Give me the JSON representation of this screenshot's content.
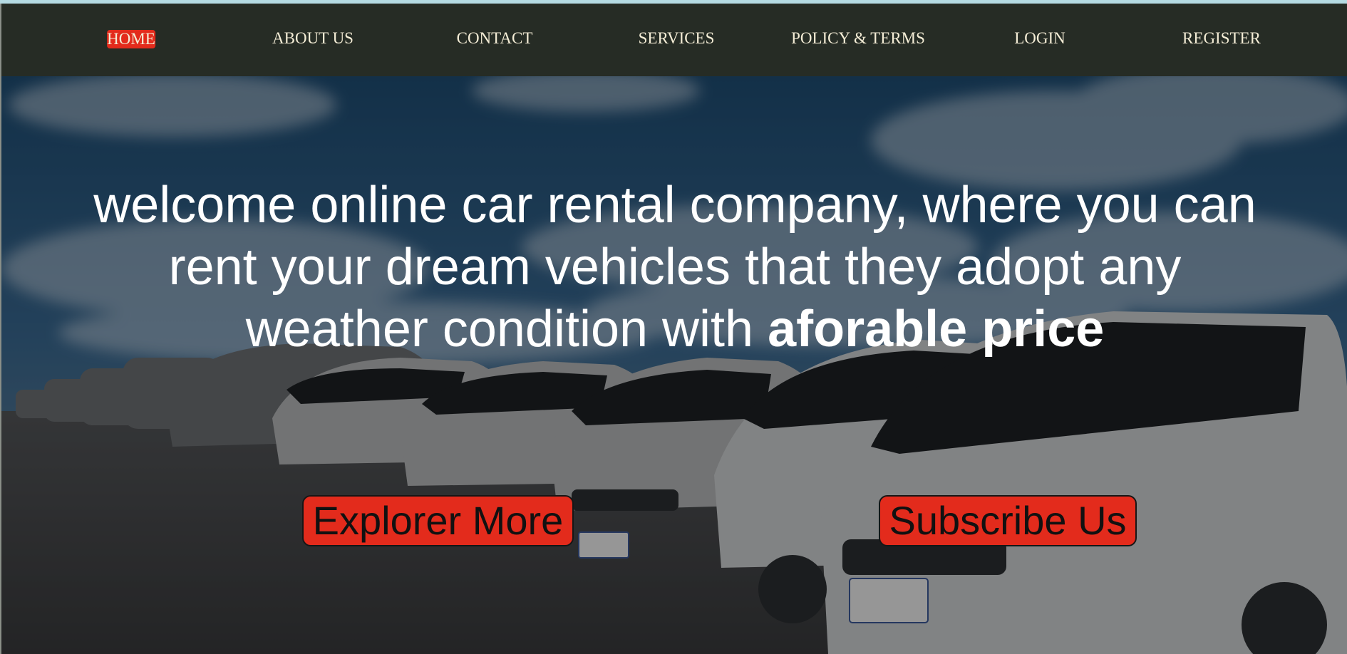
{
  "nav": {
    "items": [
      {
        "label": "HOME",
        "active": true
      },
      {
        "label": "ABOUT US",
        "active": false
      },
      {
        "label": "CONTACT",
        "active": false
      },
      {
        "label": "SERVICES",
        "active": false
      },
      {
        "label": "POLICY & TERMS",
        "active": false
      },
      {
        "label": "LOGIN",
        "active": false
      },
      {
        "label": "REGISTER",
        "active": false
      }
    ]
  },
  "hero": {
    "heading_text": "welcome online car rental company, where you can rent your dream vehicles that they adopt any weather condition with ",
    "heading_emphasis": "aforable price",
    "buttons": {
      "explore": "Explorer More",
      "subscribe": "Subscribe Us"
    }
  },
  "colors": {
    "nav_background": "#262c25",
    "nav_text": "#f4edd6",
    "accent_red": "#e32b1c",
    "top_strip": "#b5dbe3"
  }
}
